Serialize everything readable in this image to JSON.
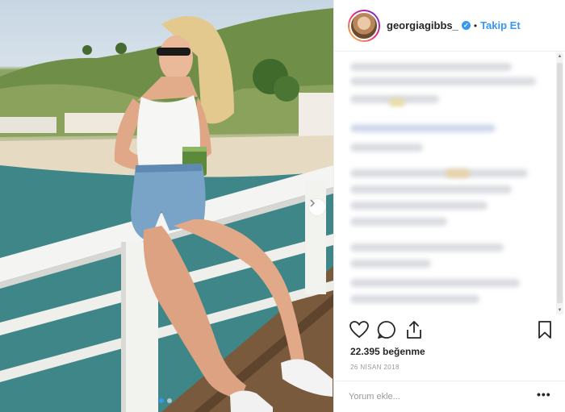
{
  "photo": {
    "alt": "",
    "next_icon": "chevron-right-icon",
    "carousel_count": 2,
    "carousel_active": 1
  },
  "header": {
    "username": "georgiagibbs_",
    "verified_icon": "verified-badge-icon",
    "separator": "•",
    "follow_label": "Takip Et"
  },
  "comments": {
    "blurred": true
  },
  "actions": {
    "like_icon": "heart-icon",
    "comment_icon": "comment-icon",
    "share_icon": "share-icon",
    "save_icon": "bookmark-icon"
  },
  "likes": "22.395 beğenme",
  "date": "26 NİSAN 2018",
  "comment_bar": {
    "placeholder": "Yorum ekle...",
    "more_label": "•••"
  },
  "colors": {
    "accent": "#3897f0",
    "text": "#262626",
    "muted": "#999999",
    "border": "#efefef"
  }
}
